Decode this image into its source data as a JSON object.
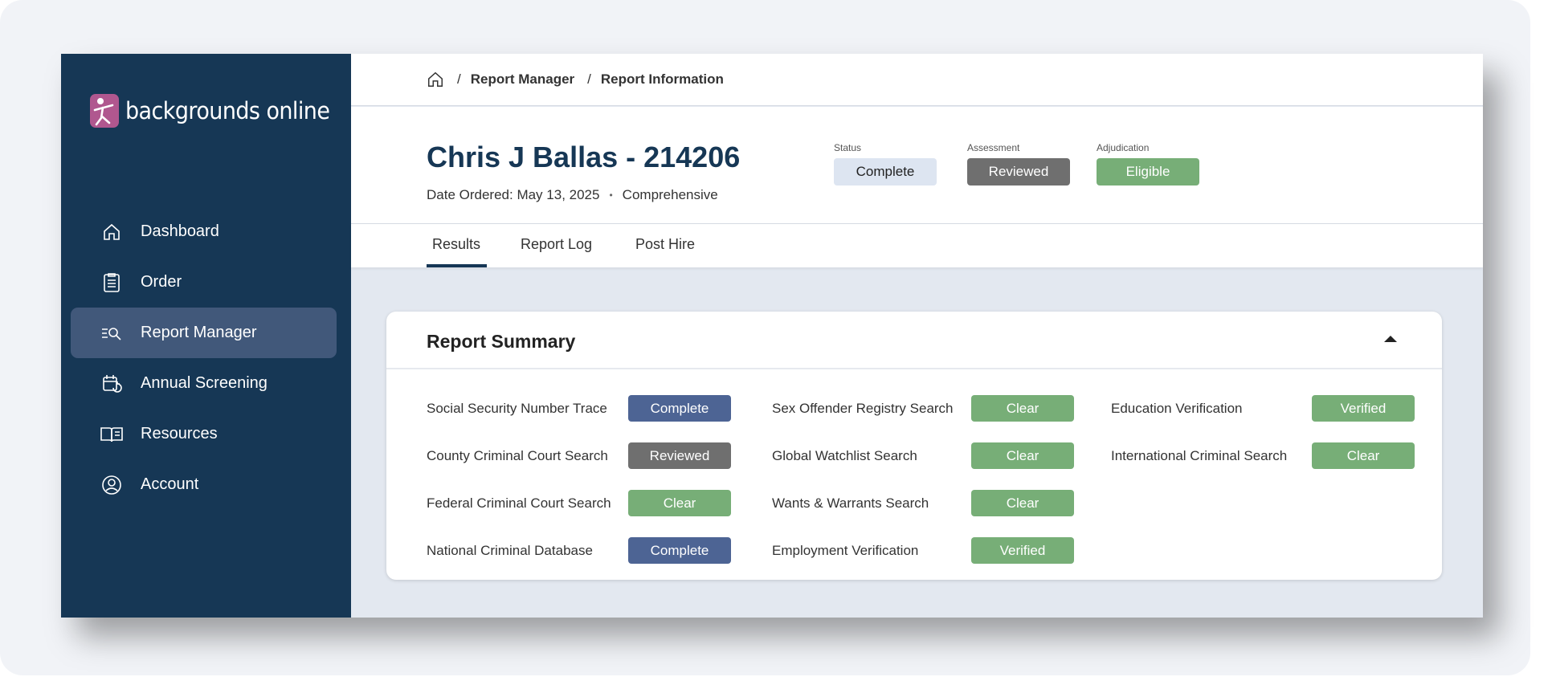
{
  "brand": {
    "name": "backgrounds online"
  },
  "sidebar": {
    "items": [
      {
        "label": "Dashboard",
        "icon": "home-icon"
      },
      {
        "label": "Order",
        "icon": "clipboard-icon"
      },
      {
        "label": "Report Manager",
        "icon": "search-list-icon",
        "active": true
      },
      {
        "label": "Annual Screening",
        "icon": "calendar-refresh-icon"
      },
      {
        "label": "Resources",
        "icon": "book-icon"
      },
      {
        "label": "Account",
        "icon": "user-circle-icon"
      }
    ]
  },
  "breadcrumb": {
    "items": [
      "Report Manager",
      "Report Information"
    ],
    "separator": "/"
  },
  "header": {
    "title": "Chris J Ballas - 214206",
    "date_ordered": "Date Ordered: May 13, 2025",
    "dot": "•",
    "package": "Comprehensive",
    "status": {
      "label": "Status",
      "value": "Complete"
    },
    "assessment": {
      "label": "Assessment",
      "value": "Reviewed"
    },
    "adjudication": {
      "label": "Adjudication",
      "value": "Eligible"
    }
  },
  "tabs": [
    {
      "label": "Results",
      "active": true
    },
    {
      "label": "Report Log"
    },
    {
      "label": "Post Hire"
    }
  ],
  "summary": {
    "title": "Report Summary",
    "columns": [
      [
        {
          "label": "Social Security Number Trace",
          "status": "Complete"
        },
        {
          "label": "County Criminal Court Search",
          "status": "Reviewed"
        },
        {
          "label": "Federal Criminal Court Search",
          "status": "Clear"
        },
        {
          "label": "National Criminal Database",
          "status": "Complete"
        }
      ],
      [
        {
          "label": "Sex Offender Registry Search",
          "status": "Clear"
        },
        {
          "label": "Global Watchlist Search",
          "status": "Clear"
        },
        {
          "label": "Wants & Warrants Search",
          "status": "Clear"
        },
        {
          "label": "Employment Verification",
          "status": "Verified"
        }
      ],
      [
        {
          "label": "Education Verification",
          "status": "Verified"
        },
        {
          "label": "International Criminal Search",
          "status": "Clear"
        }
      ]
    ]
  },
  "colors": {
    "sidebar": "#163755",
    "sidebar_active": "#41587a",
    "status_complete": "#4d6494",
    "status_reviewed": "#6f6f6f",
    "status_clear": "#77ae77"
  }
}
